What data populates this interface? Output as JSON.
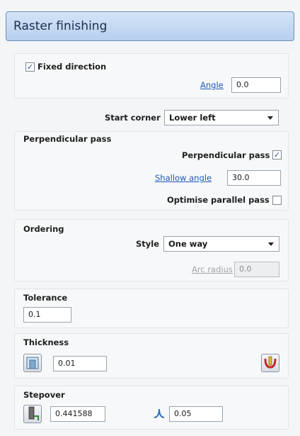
{
  "title": "Raster finishing",
  "fixed_direction": {
    "label": "Fixed direction",
    "checked": true
  },
  "angle": {
    "label": "Angle",
    "value": "0.0"
  },
  "start_corner": {
    "label": "Start corner",
    "value": "Lower left"
  },
  "perpendicular": {
    "section_label": "Perpendicular pass",
    "pass_label": "Perpendicular pass",
    "pass_checked": true,
    "shallow_label": "Shallow angle",
    "shallow_value": "30.0",
    "optimise_label": "Optimise parallel pass",
    "optimise_checked": false
  },
  "ordering": {
    "section_label": "Ordering",
    "style_label": "Style",
    "style_value": "One way",
    "arc_label": "Arc radius",
    "arc_value": "0.0"
  },
  "tolerance": {
    "label": "Tolerance",
    "value": "0.1"
  },
  "thickness": {
    "label": "Thickness",
    "value": "0.01"
  },
  "stepover": {
    "label": "Stepover",
    "value": "0.441588",
    "cusp_value": "0.05"
  },
  "icons": [
    "thickness-icon",
    "gouge-check-icon",
    "stepover-tool-icon",
    "cusp-height-icon"
  ]
}
